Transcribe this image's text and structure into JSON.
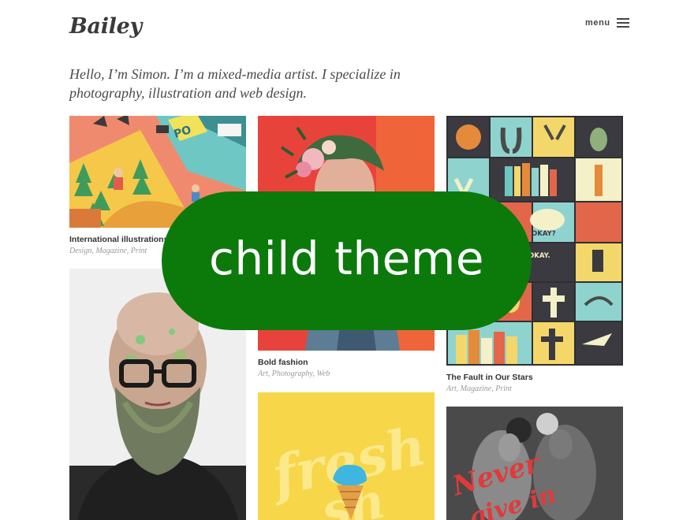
{
  "header": {
    "site_title": "Bailey",
    "menu_label": "menu"
  },
  "intro": "Hello, I’m Simon. I’m a mixed-media artist. I specialize in photography, illustration and web design.",
  "portfolio": [
    {
      "title": "International illustrations",
      "categories": "Design, Magazine, Print"
    },
    {
      "title": "Bold fashion",
      "categories": "Art, Photography, Web"
    },
    {
      "title": "The Fault in Our Stars",
      "categories": "Art, Magazine, Print"
    }
  ],
  "thumb_text": {
    "illustration_sign": "PO",
    "okay_1": "OKAY?",
    "okay_2": "OKAY.",
    "fresh_1": "fresh",
    "fresh_2": "sh",
    "never": "Never",
    "give_in": "give in"
  },
  "overlay_badge": "child theme",
  "colors": {
    "badge": "#0b7a0b",
    "illustration_bg": "#f08a6e",
    "fashion_bg": "#e8433a",
    "poster_bg": "#2f2f33",
    "fresh_bg": "#f7d64a",
    "boxing_accent": "#e03a3a"
  }
}
